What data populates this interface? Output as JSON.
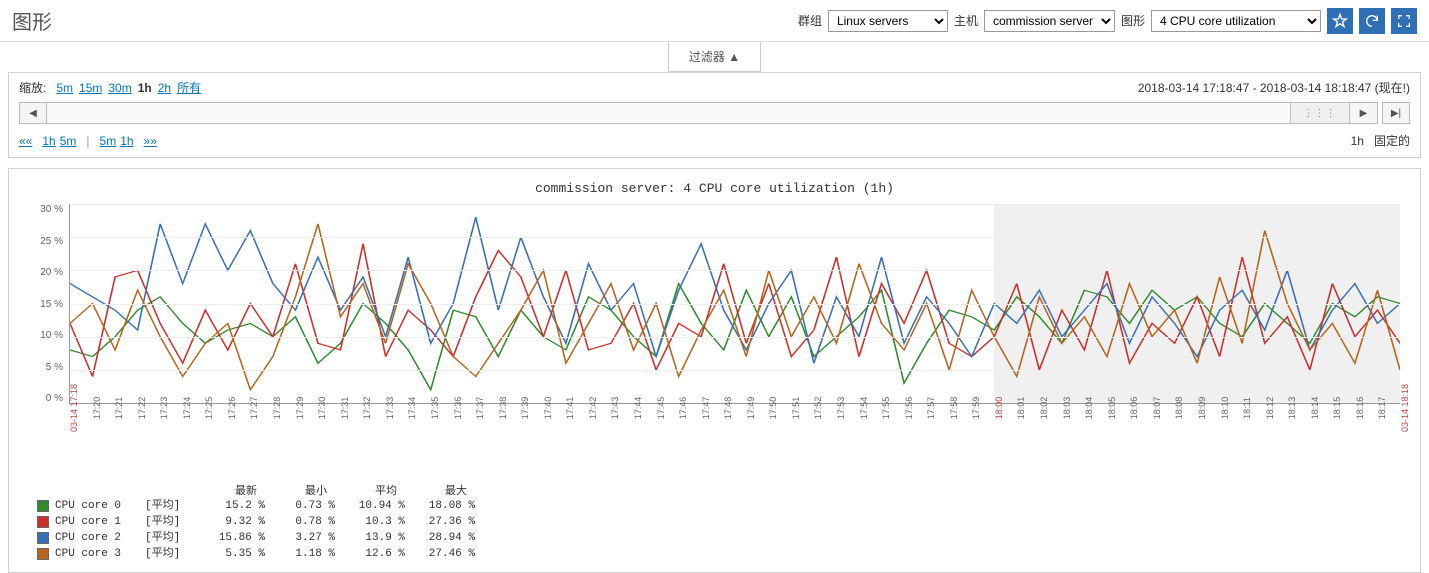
{
  "header": {
    "title": "图形",
    "group_label": "群组",
    "group_value": "Linux servers",
    "host_label": "主机",
    "host_value": "commission server",
    "graph_label": "图形",
    "graph_value": "4 CPU core utilization"
  },
  "filter_tab": "过滤器 ▲",
  "zoom": {
    "label": "缩放:",
    "options": [
      "5m",
      "15m",
      "30m",
      "1h",
      "2h",
      "所有"
    ],
    "current": "1h",
    "range_text": "2018-03-14 17:18:47 - 2018-03-14 18:18:47 (现在!)"
  },
  "nav": {
    "left_arrows": "««",
    "right_arrows": "»»",
    "left_items": [
      "1h",
      "5m"
    ],
    "right_items": [
      "5m",
      "1h"
    ],
    "right_text_1": "1h",
    "right_text_2": "固定的"
  },
  "chart_data": {
    "type": "line",
    "title": "commission server: 4 CPU core utilization (1h)",
    "ylabel": "%",
    "ylim": [
      0,
      30
    ],
    "yticks": [
      "30 %",
      "25 %",
      "20 %",
      "15 %",
      "10 %",
      "5 %",
      "0 %"
    ],
    "categories": [
      "03-14 17:18",
      "17:20",
      "17:21",
      "17:22",
      "17:23",
      "17:24",
      "17:25",
      "17:26",
      "17:27",
      "17:28",
      "17:29",
      "17:30",
      "17:31",
      "17:32",
      "17:33",
      "17:34",
      "17:35",
      "17:36",
      "17:37",
      "17:38",
      "17:39",
      "17:40",
      "17:41",
      "17:42",
      "17:43",
      "17:44",
      "17:45",
      "17:46",
      "17:47",
      "17:48",
      "17:49",
      "17:50",
      "17:51",
      "17:52",
      "17:53",
      "17:54",
      "17:55",
      "17:56",
      "17:57",
      "17:58",
      "17:59",
      "18:00",
      "18:01",
      "18:02",
      "18:03",
      "18:04",
      "18:05",
      "18:06",
      "18:07",
      "18:08",
      "18:09",
      "18:10",
      "18:11",
      "18:12",
      "18:13",
      "18:14",
      "18:15",
      "18:16",
      "18:17",
      "03-14 18:18"
    ],
    "red_ticks": [
      0,
      41,
      59
    ],
    "shade_from_index": 41,
    "series": [
      {
        "name": "CPU core 0",
        "color": "#2e8b2e",
        "values": [
          8,
          7,
          10,
          14,
          16,
          12,
          9,
          11,
          12,
          10,
          13,
          6,
          9,
          15,
          12,
          8,
          2,
          14,
          13,
          7,
          14,
          10,
          8,
          16,
          14,
          10,
          7,
          18,
          12,
          8,
          17,
          10,
          16,
          7,
          10,
          13,
          17,
          3,
          9,
          14,
          13,
          11,
          16,
          13,
          9,
          17,
          16,
          12,
          17,
          14,
          16,
          12,
          10,
          15,
          12,
          9,
          15,
          13,
          16,
          15
        ]
      },
      {
        "name": "CPU core 1",
        "color": "#c9302c",
        "values": [
          12,
          4,
          19,
          20,
          12,
          6,
          14,
          8,
          15,
          10,
          21,
          9,
          8,
          24,
          7,
          14,
          11,
          7,
          16,
          23,
          19,
          10,
          20,
          8,
          9,
          15,
          5,
          12,
          10,
          21,
          9,
          18,
          7,
          11,
          22,
          7,
          18,
          12,
          20,
          9,
          7,
          10,
          18,
          5,
          14,
          8,
          20,
          6,
          12,
          9,
          16,
          7,
          22,
          9,
          13,
          5,
          18,
          10,
          14,
          9
        ]
      },
      {
        "name": "CPU core 2",
        "color": "#3a6fb5",
        "values": [
          18,
          16,
          14,
          11,
          27,
          18,
          27,
          20,
          26,
          18,
          14,
          22,
          14,
          19,
          10,
          22,
          9,
          15,
          28,
          14,
          25,
          16,
          9,
          21,
          14,
          18,
          7,
          17,
          24,
          14,
          8,
          15,
          20,
          6,
          16,
          10,
          22,
          9,
          16,
          12,
          7,
          15,
          12,
          17,
          10,
          14,
          18,
          9,
          16,
          12,
          7,
          14,
          17,
          11,
          20,
          8,
          14,
          18,
          12,
          15
        ]
      },
      {
        "name": "CPU core 3",
        "color": "#b5651d",
        "values": [
          12,
          15,
          8,
          17,
          10,
          4,
          9,
          12,
          2,
          7,
          16,
          27,
          13,
          18,
          9,
          21,
          15,
          7,
          4,
          9,
          14,
          20,
          6,
          12,
          18,
          8,
          15,
          4,
          11,
          17,
          7,
          20,
          10,
          16,
          9,
          21,
          12,
          8,
          15,
          5,
          17,
          10,
          4,
          16,
          9,
          13,
          7,
          18,
          10,
          14,
          6,
          19,
          9,
          26,
          15,
          8,
          12,
          6,
          17,
          5
        ]
      }
    ]
  },
  "legend": {
    "headers": [
      "最新",
      "最小",
      "平均",
      "最大"
    ],
    "avg_label": "[平均]",
    "rows": [
      {
        "name": "CPU core 0",
        "color": "#2e8b2e",
        "latest": "15.2 %",
        "min": "0.73 %",
        "avg": "10.94 %",
        "max": "18.08 %"
      },
      {
        "name": "CPU core 1",
        "color": "#c9302c",
        "latest": "9.32 %",
        "min": "0.78 %",
        "avg": "10.3 %",
        "max": "27.36 %"
      },
      {
        "name": "CPU core 2",
        "color": "#3a6fb5",
        "latest": "15.86 %",
        "min": "3.27 %",
        "avg": "13.9 %",
        "max": "28.94 %"
      },
      {
        "name": "CPU core 3",
        "color": "#b5651d",
        "latest": "5.35 %",
        "min": "1.18 %",
        "avg": "12.6 %",
        "max": "27.46 %"
      }
    ]
  }
}
